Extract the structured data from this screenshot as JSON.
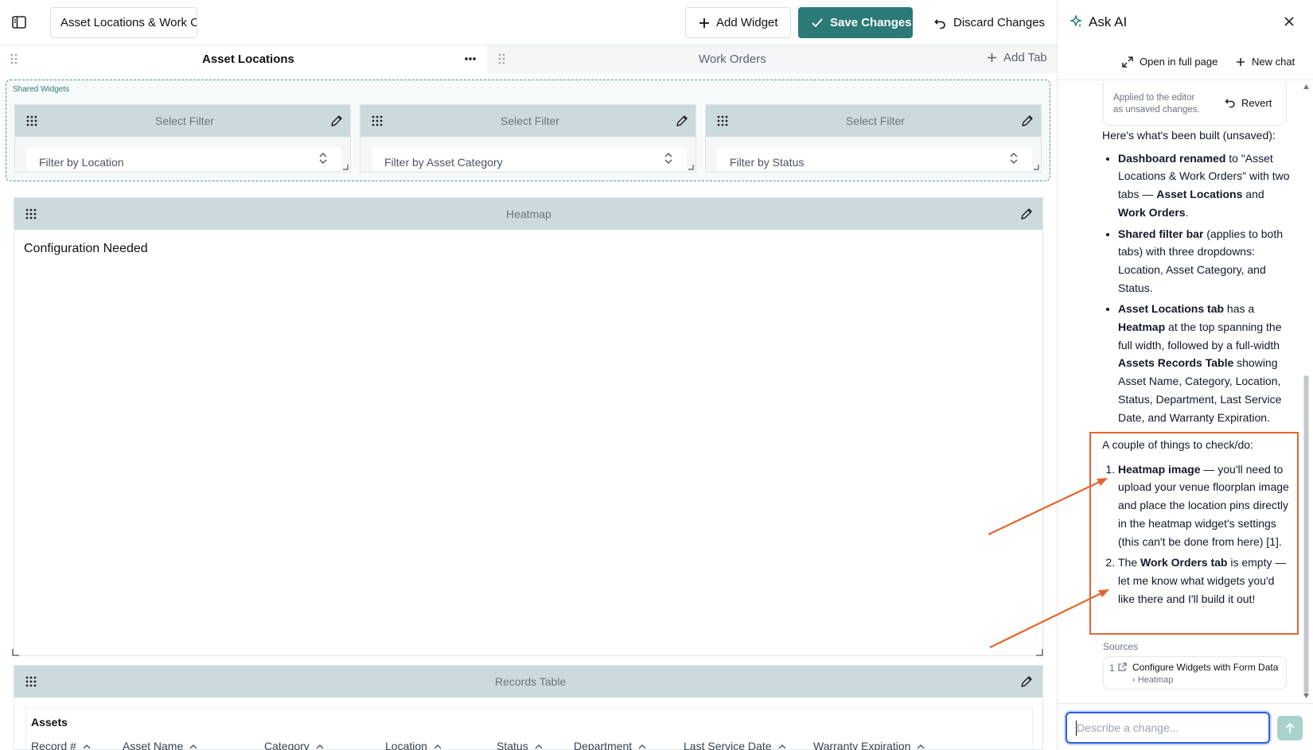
{
  "header": {
    "dashboard_title": "Asset Locations & Work C",
    "add_widget_label": "Add Widget",
    "save_label": "Save Changes",
    "discard_label": "Discard Changes"
  },
  "tabs": {
    "active_label": "Asset Locations",
    "second_label": "Work Orders",
    "add_tab_label": "Add Tab"
  },
  "shared": {
    "label": "Shared Widgets",
    "filters": [
      {
        "title": "Select Filter",
        "placeholder": "Filter by Location"
      },
      {
        "title": "Select Filter",
        "placeholder": "Filter by Asset Category"
      },
      {
        "title": "Select Filter",
        "placeholder": "Filter by Status"
      }
    ]
  },
  "heatmap": {
    "title": "Heatmap",
    "message": "Configuration Needed"
  },
  "records": {
    "title": "Records Table",
    "table_title": "Assets",
    "columns": [
      "Record #",
      "Asset Name",
      "Category",
      "Location",
      "Status",
      "Department",
      "Last Service Date",
      "Warranty Expiration"
    ]
  },
  "panel": {
    "title": "Ask AI",
    "open_full_label": "Open in full page",
    "new_chat_label": "New chat",
    "applied_line1": "Applied to the editor",
    "applied_line2": "as unsaved changes.",
    "revert_label": "Revert",
    "intro": "Here's what's been built (unsaved):",
    "b1_bold1": "Dashboard renamed",
    "b1_text1": " to \"Asset Locations & Work Orders\" with two tabs — ",
    "b1_bold2": "Asset Locations",
    "b1_text2": " and ",
    "b1_bold3": "Work Orders",
    "b1_text3": ".",
    "b2_bold1": "Shared filter bar",
    "b2_text1": " (applies to both tabs) with three dropdowns: Location, Asset Category, and Status.",
    "b3_bold1": "Asset Locations tab",
    "b3_text1": " has a ",
    "b3_bold2": "Heatmap",
    "b3_text2": " at the top spanning the full width, followed by a full-width ",
    "b3_bold3": "Assets Records Table",
    "b3_text3": " showing Asset Name, Category, Location, Status, Department, Last Service Date, and Warranty Expiration.",
    "todo_intro": "A couple of things to check/do:",
    "t1_bold": "Heatmap image",
    "t1_text": " — you'll need to upload your venue floorplan image and place the location pins directly in the heatmap widget's settings (this can't be done from here) [1].",
    "t2_text1": "The ",
    "t2_bold": "Work Orders tab",
    "t2_text2": " is empty — let me know what widgets you'd like there and I'll build it out!",
    "sources_label": "Sources",
    "source_num": "1",
    "source_line1": "Configure Widgets with Form Data",
    "source_line2": "› Heatmap",
    "input_placeholder": "Describe a change..."
  },
  "colors": {
    "accent": "#2b7a77",
    "card_header": "#cbdbdd",
    "annotation": "#e2652f"
  }
}
